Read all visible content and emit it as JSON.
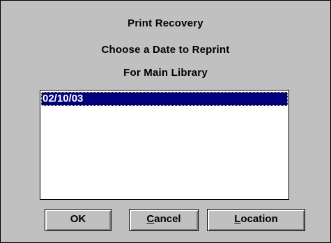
{
  "dialog": {
    "title": "Print Recovery",
    "subtitle": "Choose a Date to Reprint",
    "library": "For Main Library"
  },
  "list": {
    "items": [
      "02/10/03"
    ],
    "selected_index": 0
  },
  "buttons": {
    "ok": {
      "label": "OK"
    },
    "cancel": {
      "label": "Cancel",
      "mnemonic": "C"
    },
    "location": {
      "label": "Location",
      "mnemonic": "L"
    }
  },
  "colors": {
    "dialog_bg": "#c0c0c0",
    "selection_bg": "#00007f",
    "selection_fg": "#ffffff"
  }
}
